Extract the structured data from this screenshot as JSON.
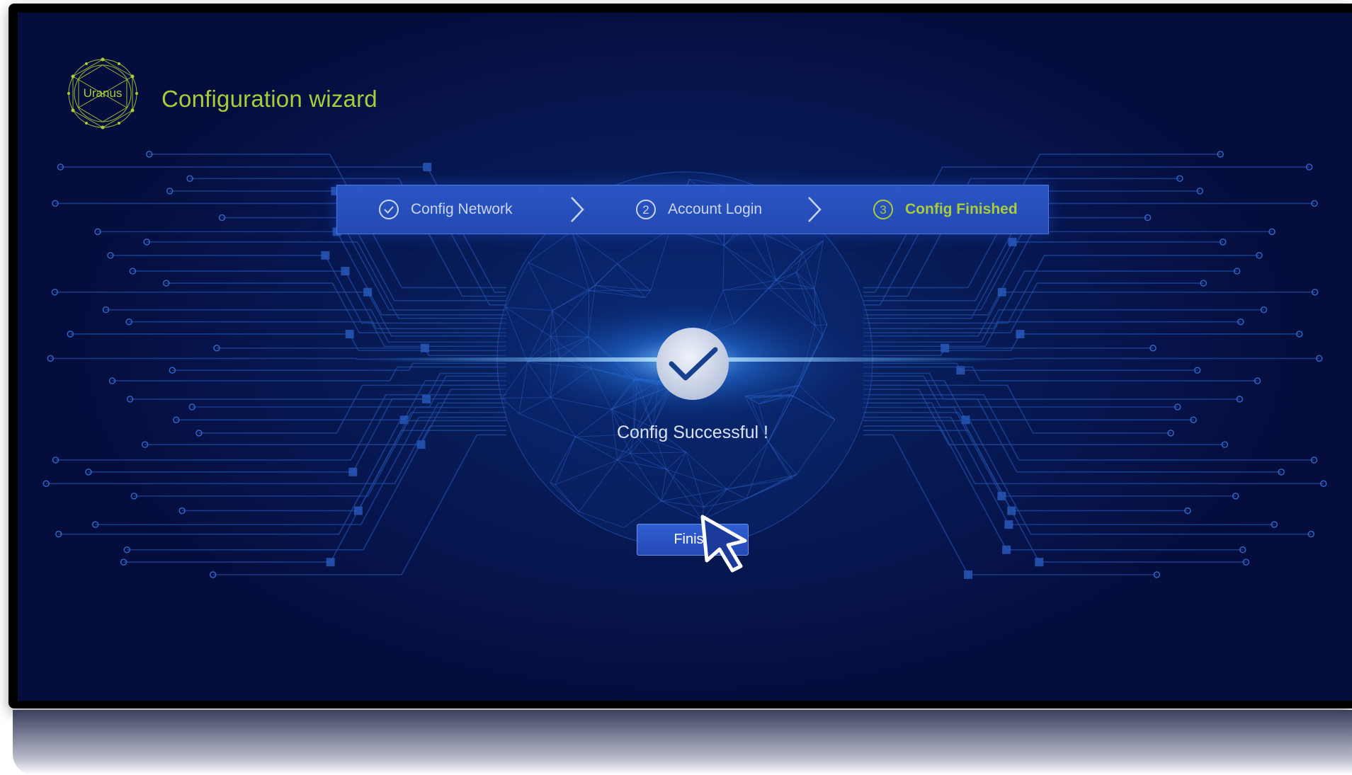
{
  "header": {
    "logo_text": "Uranus",
    "title": "Configuration wizard"
  },
  "steps": [
    {
      "number": "",
      "label": "Config Network",
      "state": "done",
      "icon": "check-circle-icon"
    },
    {
      "number": "2",
      "label": "Account Login",
      "state": "pending",
      "icon": "number-circle-icon"
    },
    {
      "number": "3",
      "label": "Config Finished",
      "state": "active",
      "icon": "number-circle-icon"
    }
  ],
  "result": {
    "icon": "success-check-icon",
    "message": "Config Successful !"
  },
  "actions": {
    "finish_label": "Finish"
  },
  "colors": {
    "accent_green": "#a9cc3a",
    "step_bar_blue": "#2449b3",
    "background_navy": "#06134a"
  }
}
